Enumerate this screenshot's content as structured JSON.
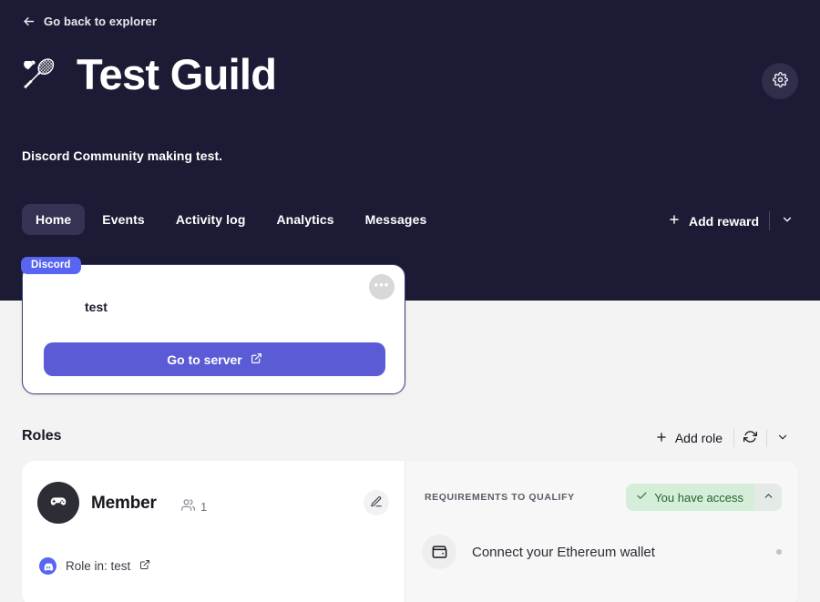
{
  "header": {
    "back_label": "Go back to explorer",
    "back_icon": "arrow-left-icon",
    "guild_emoji": "🏸",
    "guild_title": "Test Guild",
    "guild_description": "Discord Community making test.",
    "settings_icon": "gear-icon"
  },
  "tabs": [
    {
      "label": "Home",
      "active": true
    },
    {
      "label": "Events",
      "active": false
    },
    {
      "label": "Activity log",
      "active": false
    },
    {
      "label": "Analytics",
      "active": false
    },
    {
      "label": "Messages",
      "active": false
    }
  ],
  "hero_actions": {
    "add_reward_label": "Add reward",
    "plus_icon": "plus-icon",
    "chevron_icon": "chevron-down-icon"
  },
  "platform_card": {
    "badge": "Discord",
    "more_icon": "ellipsis-icon",
    "more_label": "•••",
    "name": "test",
    "cta_label": "Go to server",
    "cta_icon": "external-link-icon"
  },
  "roles": {
    "section_title": "Roles",
    "add_role_label": "Add role",
    "plus_icon": "plus-icon",
    "refresh_icon": "refresh-icon",
    "chevron_icon": "chevron-down-icon",
    "card": {
      "avatar_icon": "gamepad-icon",
      "title": "Member",
      "members_icon": "users-icon",
      "members_count": "1",
      "edit_icon": "pencil-icon",
      "role_in_label": "Role in: test",
      "role_in_platform_icon": "discord-icon",
      "role_in_external_icon": "external-link-icon"
    },
    "requirements": {
      "label": "REQUIREMENTS TO QUALIFY",
      "access_badge": "You have access",
      "access_check_icon": "check-icon",
      "access_chevron_icon": "chevron-up-icon",
      "items": [
        {
          "icon": "wallet-icon",
          "text": "Connect your Ethereum wallet"
        }
      ]
    }
  },
  "colors": {
    "hero_bg": "#1c1b35",
    "page_bg": "#f3f3f4",
    "discord_blurple": "#5865f2",
    "cta_indigo": "#5b5bd6",
    "success_bg": "#d5eed9",
    "success_text": "#27632f"
  }
}
